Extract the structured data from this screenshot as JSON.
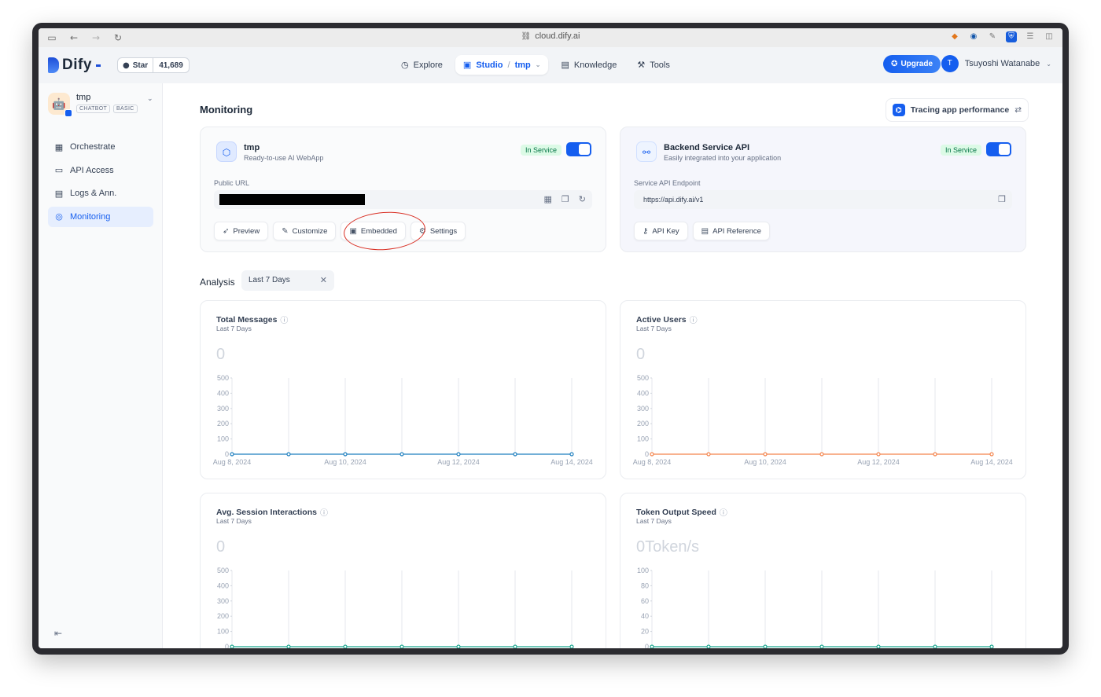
{
  "browser": {
    "url": "cloud.dify.ai"
  },
  "header": {
    "logo": "Dify",
    "github": {
      "label": "Star",
      "count": "41,689"
    },
    "nav": [
      {
        "label": "Explore"
      },
      {
        "label": "Studio",
        "crumb": "tmp"
      },
      {
        "label": "Knowledge"
      },
      {
        "label": "Tools"
      }
    ],
    "upgrade": "Upgrade",
    "user": {
      "initial": "T",
      "name": "Tsuyoshi Watanabe"
    }
  },
  "sidebar": {
    "app": {
      "name": "tmp",
      "tags": [
        "CHATBOT",
        "BASIC"
      ]
    },
    "items": [
      {
        "label": "Orchestrate"
      },
      {
        "label": "API Access"
      },
      {
        "label": "Logs & Ann."
      },
      {
        "label": "Monitoring"
      }
    ]
  },
  "main": {
    "title": "Monitoring",
    "tracing": "Tracing app performance",
    "webapp": {
      "title": "tmp",
      "subtitle": "Ready-to-use AI WebApp",
      "status": "In Service",
      "field_label": "Public URL",
      "buttons": [
        "Preview",
        "Customize",
        "Embedded",
        "Settings"
      ]
    },
    "api": {
      "title": "Backend Service API",
      "subtitle": "Easily integrated into your application",
      "status": "In Service",
      "field_label": "Service API Endpoint",
      "endpoint": "https://api.dify.ai/v1",
      "buttons": [
        "API Key",
        "API Reference"
      ]
    },
    "analysis": {
      "label": "Analysis",
      "period": "Last 7 Days"
    },
    "charts": [
      {
        "title": "Total Messages",
        "subtitle": "Last 7 Days",
        "value": "0"
      },
      {
        "title": "Active Users",
        "subtitle": "Last 7 Days",
        "value": "0"
      },
      {
        "title": "Avg. Session Interactions",
        "subtitle": "Last 7 Days",
        "value": "0"
      },
      {
        "title": "Token Output Speed",
        "subtitle": "Last 7 Days",
        "value": "0Token/s"
      }
    ]
  },
  "colors": {
    "accent": "#155eef",
    "series_blue": "#1e7fbf",
    "series_orange": "#f4844c",
    "series_teal": "#1aa68f",
    "annotation": "#d93025"
  },
  "chart_data": [
    {
      "type": "line",
      "title": "Total Messages",
      "x": [
        "Aug 8, 2024",
        "Aug 9, 2024",
        "Aug 10, 2024",
        "Aug 11, 2024",
        "Aug 12, 2024",
        "Aug 13, 2024",
        "Aug 14, 2024"
      ],
      "x_tick_labels": [
        "Aug 8, 2024",
        "Aug 10, 2024",
        "Aug 12, 2024",
        "Aug 14, 2024"
      ],
      "y": [
        0,
        0,
        0,
        0,
        0,
        0,
        0
      ],
      "yticks": [
        0,
        100,
        200,
        300,
        400,
        500
      ],
      "ylim": [
        0,
        500
      ],
      "color": "#1e7fbf",
      "grid": "vertical"
    },
    {
      "type": "line",
      "title": "Active Users",
      "x": [
        "Aug 8, 2024",
        "Aug 9, 2024",
        "Aug 10, 2024",
        "Aug 11, 2024",
        "Aug 12, 2024",
        "Aug 13, 2024",
        "Aug 14, 2024"
      ],
      "x_tick_labels": [
        "Aug 8, 2024",
        "Aug 10, 2024",
        "Aug 12, 2024",
        "Aug 14, 2024"
      ],
      "y": [
        0,
        0,
        0,
        0,
        0,
        0,
        0
      ],
      "yticks": [
        0,
        100,
        200,
        300,
        400,
        500
      ],
      "ylim": [
        0,
        500
      ],
      "color": "#f4844c",
      "grid": "vertical"
    },
    {
      "type": "line",
      "title": "Avg. Session Interactions",
      "x": [
        "Aug 8, 2024",
        "Aug 9, 2024",
        "Aug 10, 2024",
        "Aug 11, 2024",
        "Aug 12, 2024",
        "Aug 13, 2024",
        "Aug 14, 2024"
      ],
      "x_tick_labels": [],
      "y": [
        0,
        0,
        0,
        0,
        0,
        0,
        0
      ],
      "yticks": [
        0,
        100,
        200,
        300,
        400,
        500
      ],
      "ylim": [
        0,
        500
      ],
      "color": "#1aa68f",
      "grid": "vertical"
    },
    {
      "type": "line",
      "title": "Token Output Speed",
      "x": [
        "Aug 8, 2024",
        "Aug 9, 2024",
        "Aug 10, 2024",
        "Aug 11, 2024",
        "Aug 12, 2024",
        "Aug 13, 2024",
        "Aug 14, 2024"
      ],
      "x_tick_labels": [],
      "y": [
        0,
        0,
        0,
        0,
        0,
        0,
        0
      ],
      "yticks": [
        0,
        20,
        40,
        60,
        80,
        100
      ],
      "ylim": [
        0,
        100
      ],
      "color": "#1aa68f",
      "grid": "vertical"
    }
  ]
}
